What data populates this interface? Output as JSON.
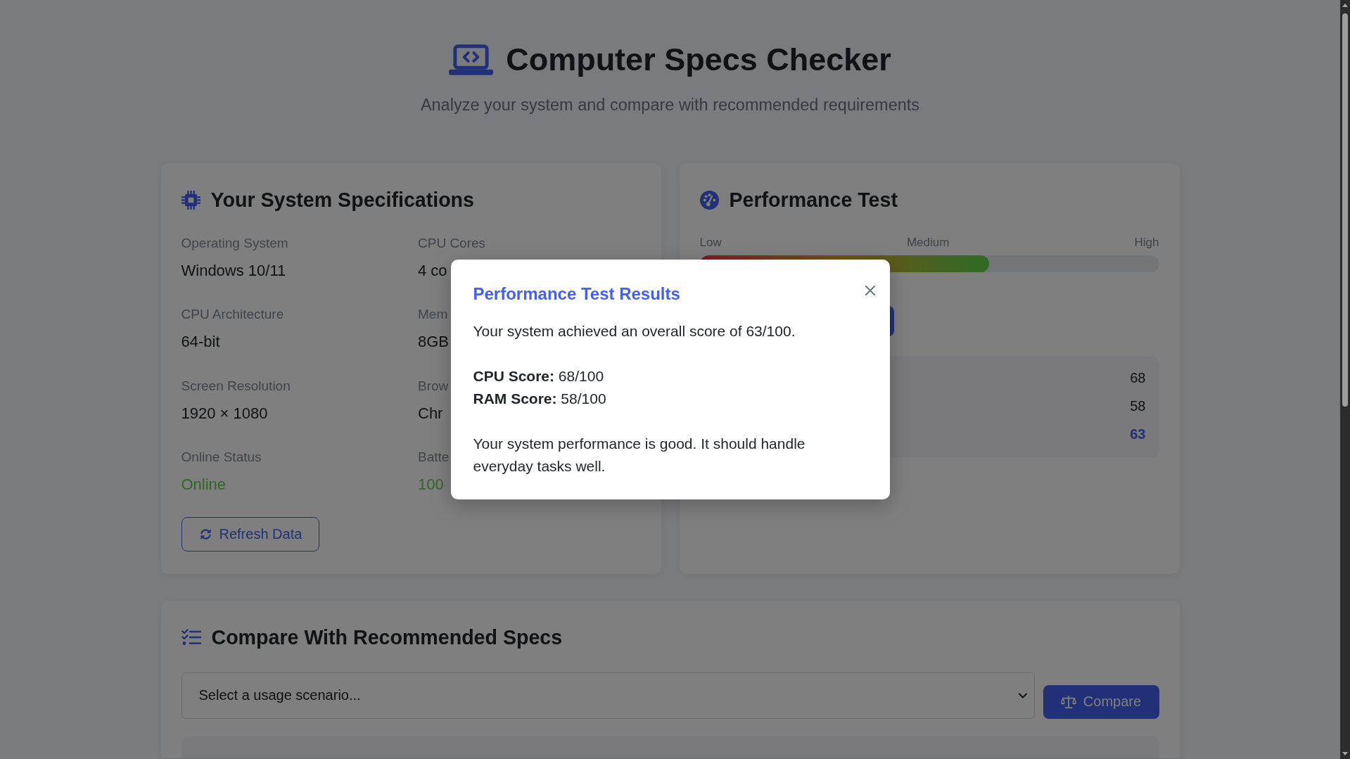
{
  "header": {
    "title": "Computer Specs Checker",
    "subtitle": "Analyze your system and compare with recommended requirements"
  },
  "system_specs": {
    "title": "Your System Specifications",
    "items": [
      {
        "label": "Operating System",
        "value": "Windows 10/11",
        "positive": false
      },
      {
        "label": "CPU Cores",
        "value": "4 co",
        "positive": false
      },
      {
        "label": "CPU Architecture",
        "value": "64-bit",
        "positive": false
      },
      {
        "label": "Mem",
        "value": "8GB",
        "positive": false
      },
      {
        "label": "Screen Resolution",
        "value": "1920 × 1080",
        "positive": false
      },
      {
        "label": "Brow",
        "value": "Chr",
        "positive": false
      },
      {
        "label": "Online Status",
        "value": "Online",
        "positive": true
      },
      {
        "label": "Batte",
        "value": "100",
        "positive": true
      }
    ],
    "refresh_button": "Refresh Data"
  },
  "performance_test": {
    "title": "Performance Test",
    "scale_labels": [
      "Low",
      "Medium",
      "High"
    ],
    "meter": {
      "level": 0.63
    },
    "results": [
      {
        "value": "68",
        "kind": "score"
      },
      {
        "value": "58",
        "kind": "score"
      },
      {
        "value": "63",
        "kind": "total"
      }
    ]
  },
  "compare": {
    "title": "Compare With Recommended Specs",
    "select": {
      "placeholder": "Select a usage scenario..."
    },
    "button": "Compare"
  },
  "modal": {
    "title": "Performance Test Results",
    "summary": "Your system achieved an overall score of 63/100.",
    "scores": [
      "**CPU Score:** 68/100",
      "**RAM Score:** 58/100"
    ],
    "verdict": "Your system performance is good. It should handle everyday tasks well."
  }
}
